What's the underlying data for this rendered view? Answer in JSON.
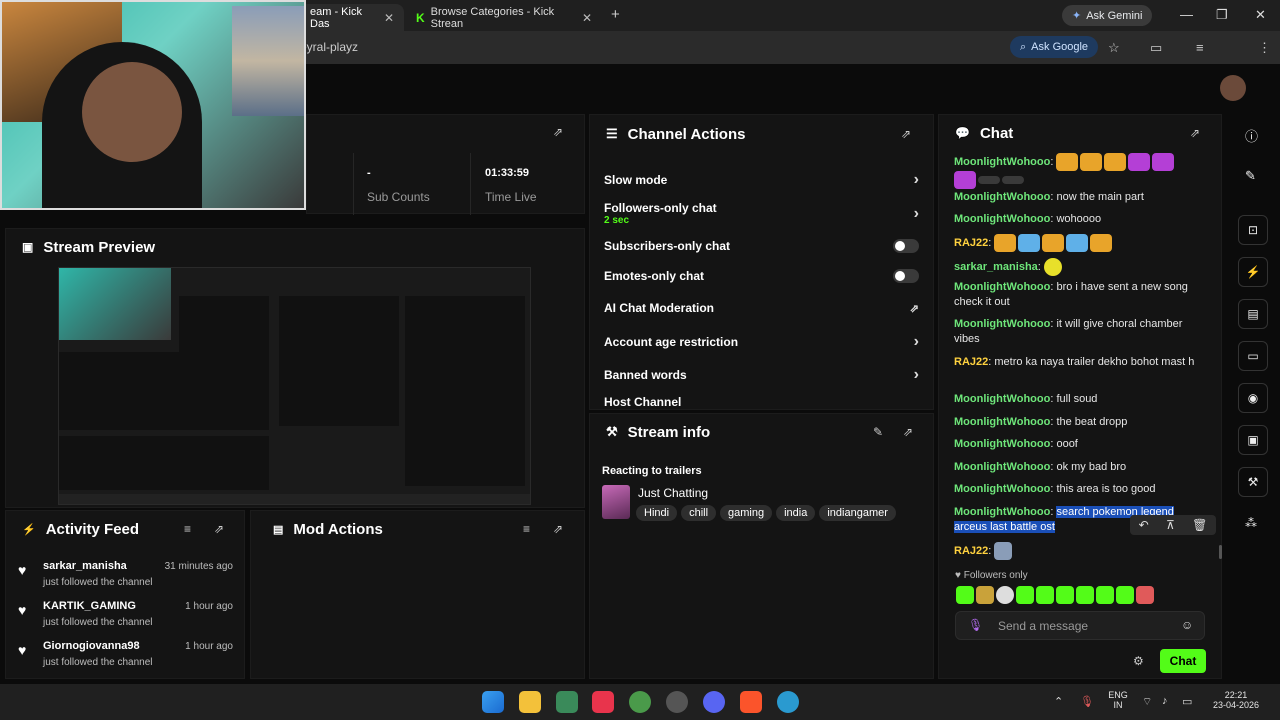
{
  "browser": {
    "tabs": [
      {
        "label": "eam - Kick Das",
        "active": true
      },
      {
        "label": "Browse Categories - Kick Strean",
        "active": false
      }
    ],
    "ask_gemini": "Ask Gemini",
    "address_fragment": "eyral-playz",
    "ask_google": "Ask Google"
  },
  "stats": {
    "sub_counts_value": "-",
    "sub_counts_label": "Sub Counts",
    "time_live_value": "01:33:59",
    "time_live_label": "Time Live"
  },
  "stream_preview": {
    "title": "Stream Preview"
  },
  "channel_actions": {
    "title": "Channel Actions",
    "items": [
      {
        "label": "Slow mode"
      },
      {
        "label": "Followers-only chat",
        "sub": "2 sec"
      },
      {
        "label": "Subscribers-only chat"
      },
      {
        "label": "Emotes-only chat"
      },
      {
        "label": "AI Chat Moderation"
      },
      {
        "label": "Account age restriction"
      },
      {
        "label": "Banned words"
      },
      {
        "label": "Host Channel"
      }
    ]
  },
  "stream_info": {
    "title": "Stream info",
    "stream_title": "Reacting to trailers",
    "category": "Just Chatting",
    "tags": [
      "Hindi",
      "chill",
      "gaming",
      "india",
      "indiangamer"
    ]
  },
  "chat": {
    "title": "Chat",
    "messages": [
      {
        "user": "MoonlightWohooo",
        "text": ""
      },
      {
        "user": "MoonlightWohooo",
        "text": "now the main part"
      },
      {
        "user": "MoonlightWohooo",
        "text": "wohoooo"
      },
      {
        "user": "RAJ22",
        "text": ""
      },
      {
        "user": "sarkar_manisha",
        "text": ""
      },
      {
        "user": "MoonlightWohooo",
        "text": "bro i have sent a new song check it out"
      },
      {
        "user": "MoonlightWohooo",
        "text": "it will give choral chamber vibes"
      },
      {
        "user": "RAJ22",
        "text": "metro ka naya trailer dekho bohot mast h"
      },
      {
        "user": "MoonlightWohooo",
        "text": "full soud"
      },
      {
        "user": "MoonlightWohooo",
        "text": "the beat dropp"
      },
      {
        "user": "MoonlightWohooo",
        "text": "ooof"
      },
      {
        "user": "MoonlightWohooo",
        "text": "ok my bad bro"
      },
      {
        "user": "MoonlightWohooo",
        "text": "this area is too good"
      },
      {
        "user": "MoonlightWohooo",
        "text": "search pokemon legend arceus last battle ost"
      },
      {
        "user": "RAJ22",
        "text": ""
      }
    ],
    "followers_only": "Followers only",
    "placeholder": "Send a message",
    "send_label": "Chat"
  },
  "activity_feed": {
    "title": "Activity Feed",
    "items": [
      {
        "name": "sarkar_manisha",
        "time": "31 minutes ago",
        "action": "just followed the channel"
      },
      {
        "name": "KARTIK_GAMING",
        "time": "1 hour ago",
        "action": "just followed the channel"
      },
      {
        "name": "Giornogiovanna98",
        "time": "1 hour ago",
        "action": "just followed the channel"
      }
    ]
  },
  "mod_actions": {
    "title": "Mod Actions"
  },
  "taskbar": {
    "lang_top": "ENG",
    "lang_bottom": "IN",
    "time": "22:21",
    "date": "23-04-2026"
  },
  "colors": {
    "accent": "#53fc18",
    "panel": "#141414",
    "highlight": "#1a4fb8"
  }
}
